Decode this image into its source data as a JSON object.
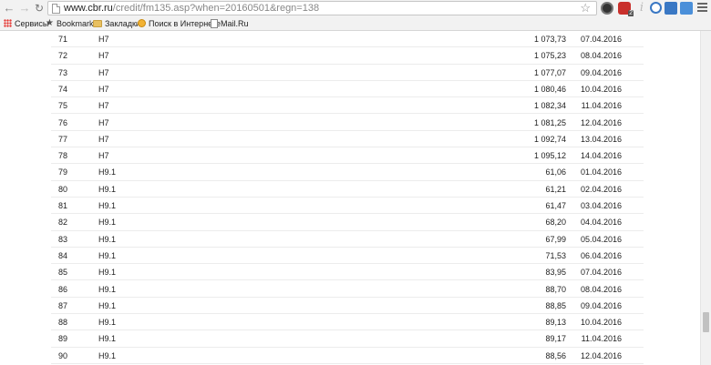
{
  "browser": {
    "url_host": "www.cbr.ru",
    "url_path": "/credit/fm135.asp?when=20160501&regn=138"
  },
  "bookmarks": [
    {
      "label": "Сервисы",
      "icon": "apps-grid-icon"
    },
    {
      "label": "Bookmarks",
      "icon": "star-icon"
    },
    {
      "label": "Закладки",
      "icon": "folder-icon"
    },
    {
      "label": "Поиск в Интернете",
      "icon": "search-icon"
    },
    {
      "label": "Mail.Ru",
      "icon": "page-icon"
    }
  ],
  "table": {
    "rows": [
      {
        "num": "71",
        "code": "Н7",
        "value": "1 073,73",
        "date": "07.04.2016"
      },
      {
        "num": "72",
        "code": "Н7",
        "value": "1 075,23",
        "date": "08.04.2016"
      },
      {
        "num": "73",
        "code": "Н7",
        "value": "1 077,07",
        "date": "09.04.2016"
      },
      {
        "num": "74",
        "code": "Н7",
        "value": "1 080,46",
        "date": "10.04.2016"
      },
      {
        "num": "75",
        "code": "Н7",
        "value": "1 082,34",
        "date": "11.04.2016"
      },
      {
        "num": "76",
        "code": "Н7",
        "value": "1 081,25",
        "date": "12.04.2016"
      },
      {
        "num": "77",
        "code": "Н7",
        "value": "1 092,74",
        "date": "13.04.2016"
      },
      {
        "num": "78",
        "code": "Н7",
        "value": "1 095,12",
        "date": "14.04.2016"
      },
      {
        "num": "79",
        "code": "Н9.1",
        "value": "61,06",
        "date": "01.04.2016"
      },
      {
        "num": "80",
        "code": "Н9.1",
        "value": "61,21",
        "date": "02.04.2016"
      },
      {
        "num": "81",
        "code": "Н9.1",
        "value": "61,47",
        "date": "03.04.2016"
      },
      {
        "num": "82",
        "code": "Н9.1",
        "value": "68,20",
        "date": "04.04.2016"
      },
      {
        "num": "83",
        "code": "Н9.1",
        "value": "67,99",
        "date": "05.04.2016"
      },
      {
        "num": "84",
        "code": "Н9.1",
        "value": "71,53",
        "date": "06.04.2016"
      },
      {
        "num": "85",
        "code": "Н9.1",
        "value": "83,95",
        "date": "07.04.2016"
      },
      {
        "num": "86",
        "code": "Н9.1",
        "value": "88,70",
        "date": "08.04.2016"
      },
      {
        "num": "87",
        "code": "Н9.1",
        "value": "88,85",
        "date": "09.04.2016"
      },
      {
        "num": "88",
        "code": "Н9.1",
        "value": "89,13",
        "date": "10.04.2016"
      },
      {
        "num": "89",
        "code": "Н9.1",
        "value": "89,17",
        "date": "11.04.2016"
      },
      {
        "num": "90",
        "code": "Н9.1",
        "value": "88,56",
        "date": "12.04.2016"
      }
    ]
  }
}
